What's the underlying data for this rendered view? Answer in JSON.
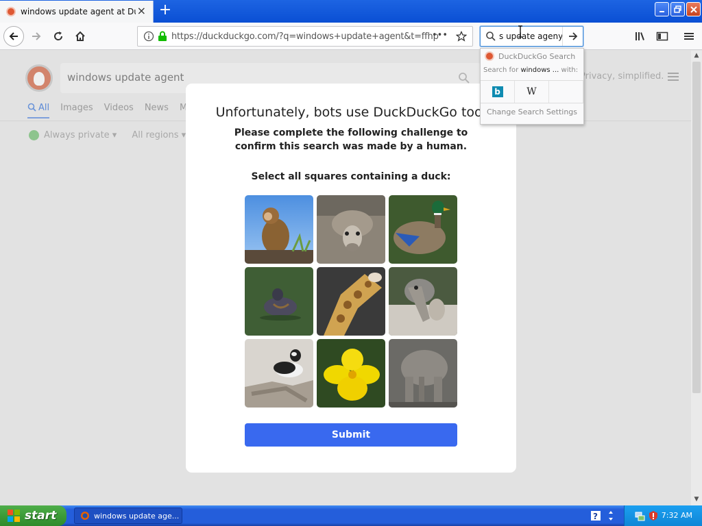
{
  "browser": {
    "tab_title": "windows update agent at DuckDuckGo",
    "tab_close": "×",
    "new_tab": "+",
    "url": "https://duckduckgo.com/?q=windows+update+agent&t=ffhp",
    "page_actions": "•••",
    "search_value": "s update ageny"
  },
  "search_dropdown": {
    "engine_label": "DuckDuckGo Search",
    "search_for_prefix": "Search for ",
    "search_for_term": "windows ...",
    "search_for_suffix": " with:",
    "bing_label": "b",
    "wiki_label": "W",
    "settings_label": "Change Search Settings"
  },
  "page": {
    "search_query": "windows update agent",
    "tagline": "Privacy, simplified.",
    "tabs": [
      "All",
      "Images",
      "Videos",
      "News",
      "M"
    ],
    "filter_private": "Always private ▾",
    "filter_regions": "All regions ▾"
  },
  "challenge": {
    "title": "Unfortunately, bots use DuckDuckGo too.",
    "subtitle": "Please complete the following challenge to confirm this search was made by a human.",
    "prompt": "Select all squares containing a duck:",
    "tiles": [
      "monkey",
      "donkey",
      "mallard duck",
      "duck in water",
      "giraffe",
      "camel",
      "bufflehead duck",
      "yellow flower",
      "elephant"
    ],
    "submit_label": "Submit"
  },
  "taskbar": {
    "start_label": "start",
    "window_item": "windows update age...",
    "clock": "7:32 AM"
  },
  "colors": {
    "accent": "#3969ef",
    "ddg_orange": "#de5833",
    "xp_blue": "#245edb",
    "xp_green": "#3c9b38"
  }
}
